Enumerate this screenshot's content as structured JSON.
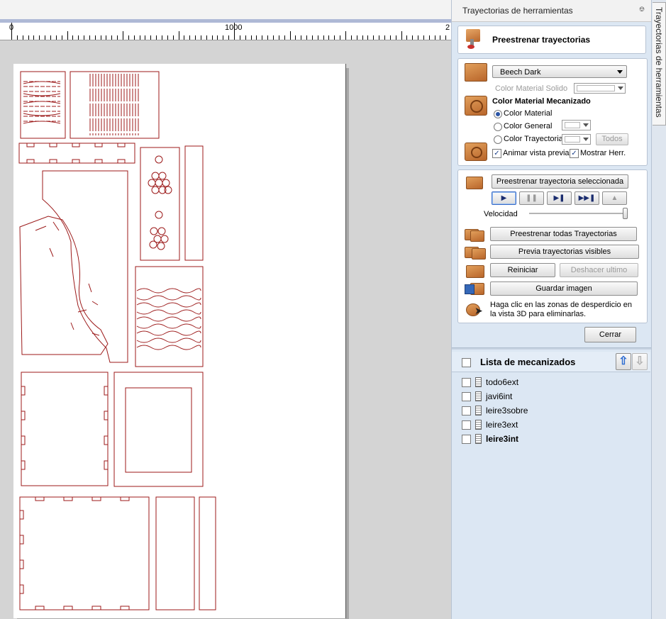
{
  "ruler": {
    "label_0": "0",
    "label_1000": "1000",
    "label_end": "2"
  },
  "panel": {
    "title": "Trayectorias de herramientas",
    "side_tab": "Trayectorias de herramientas",
    "preview_header": "Preestrenar trayectorias",
    "material": {
      "selected": "Beech Dark",
      "solid_color_label": "Color Material Solido",
      "machined_color_heading": "Color Material Mecanizado",
      "options": [
        "Color Material",
        "Color General",
        "Color Trayectoria"
      ],
      "selected_option": "Color Material",
      "todos_label": "Todos",
      "animate_label": "Animar vista previa",
      "animate_checked": true,
      "show_tool_label": "Mostrar Herr.",
      "show_tool_checked": true
    },
    "playback": {
      "preview_selected": "Preestrenar trayectoria seleccionada",
      "speed_label": "Velocidad",
      "speed_value": 1.0,
      "preview_all": "Preestrenar todas Trayectorias",
      "preview_visible": "Previa trayectorias visibles",
      "reset": "Reiniciar",
      "undo_last": "Deshacer ultimo",
      "save_image": "Guardar imagen",
      "waste_hint": "Haga clic en las zonas de desperdicio en la vista 3D para eliminarlas."
    },
    "close_label": "Cerrar",
    "list": {
      "heading": "Lista de mecanizados",
      "items": [
        {
          "name": "todo6ext",
          "bold": false
        },
        {
          "name": "javi6int",
          "bold": false
        },
        {
          "name": "leire3sobre",
          "bold": false
        },
        {
          "name": "leire3ext",
          "bold": false
        },
        {
          "name": "leire3int",
          "bold": true
        }
      ]
    }
  },
  "colors": {
    "part_outline": "#9c1a1a",
    "panel_bg": "#dce7f3",
    "accent_blue": "#2b55a6"
  }
}
